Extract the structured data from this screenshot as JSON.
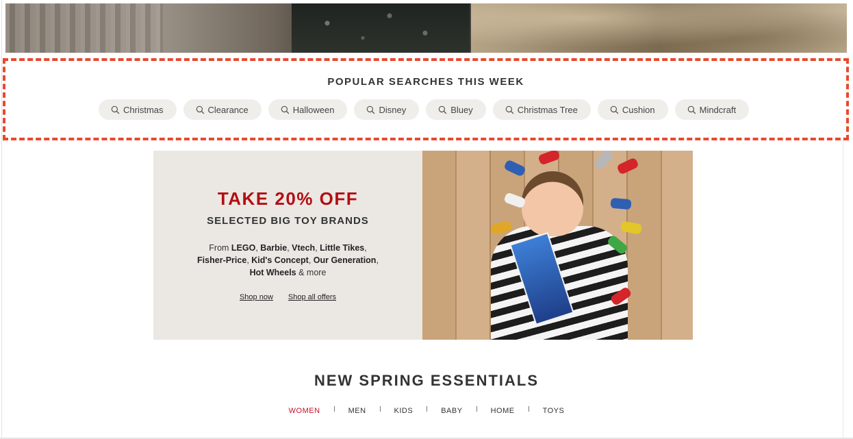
{
  "popular_searches": {
    "title": "POPULAR SEARCHES THIS WEEK",
    "items": [
      {
        "label": "Christmas",
        "icon": "search-icon"
      },
      {
        "label": "Clearance",
        "icon": "search-icon"
      },
      {
        "label": "Halloween",
        "icon": "search-icon"
      },
      {
        "label": "Disney",
        "icon": "search-icon"
      },
      {
        "label": "Bluey",
        "icon": "search-icon"
      },
      {
        "label": "Christmas Tree",
        "icon": "search-icon"
      },
      {
        "label": "Cushion",
        "icon": "search-icon"
      },
      {
        "label": "Mindcraft",
        "icon": "search-icon"
      }
    ]
  },
  "promo": {
    "title": "TAKE 20% OFF",
    "subtitle": "SELECTED BIG TOY BRANDS",
    "body_prefix": "From ",
    "brands": [
      "LEGO",
      "Barbie",
      "Vtech",
      "Little Tikes",
      "Fisher-Price",
      "Kid's Concept",
      "Our Generation",
      "Hot Wheels"
    ],
    "body_suffix": " & more",
    "shop_now": "Shop now",
    "shop_all": "Shop all offers"
  },
  "spring": {
    "title": "NEW SPRING ESSENTIALS",
    "tabs": [
      {
        "label": "WOMEN",
        "active": true
      },
      {
        "label": "MEN",
        "active": false
      },
      {
        "label": "KIDS",
        "active": false
      },
      {
        "label": "BABY",
        "active": false
      },
      {
        "label": "HOME",
        "active": false
      },
      {
        "label": "TOYS",
        "active": false
      }
    ]
  },
  "colors": {
    "accent_red": "#b40e12",
    "highlight_dash": "#e8492d",
    "chip_bg": "#efeeeb",
    "promo_bg": "#ebe8e4"
  }
}
